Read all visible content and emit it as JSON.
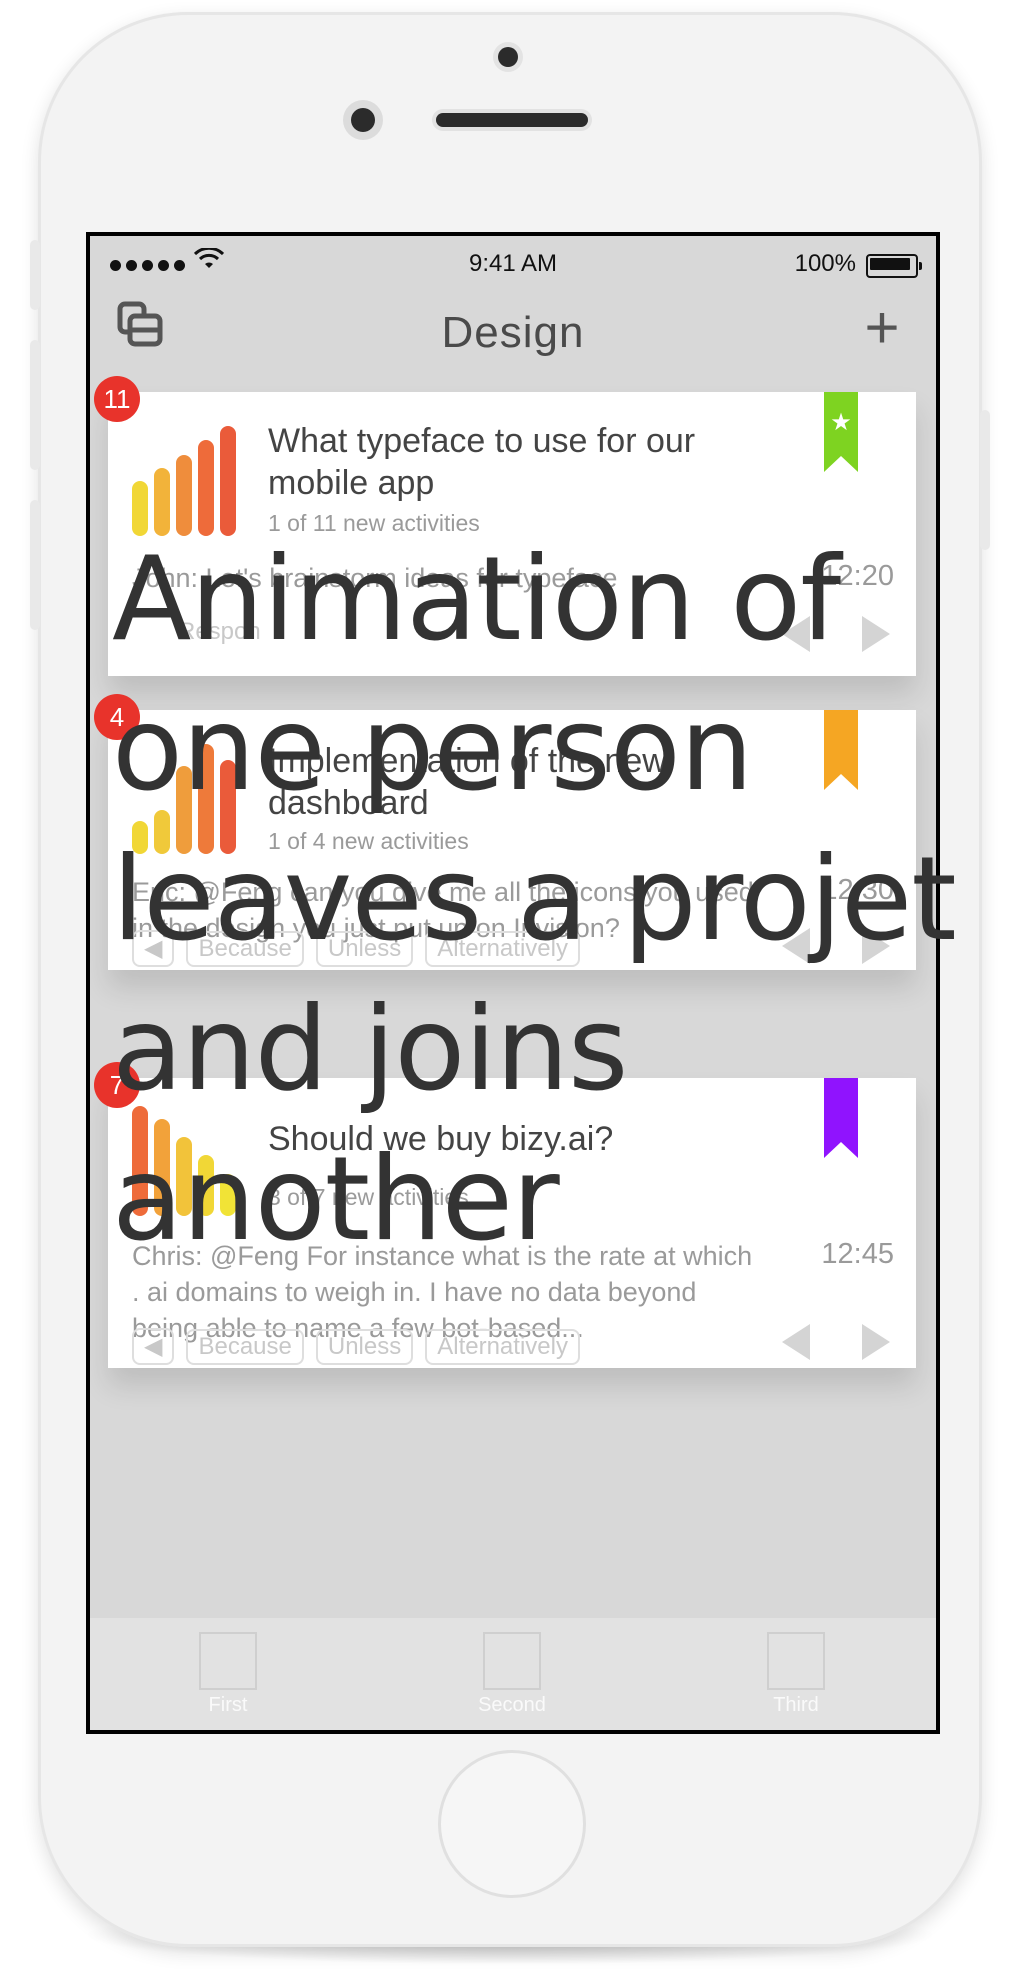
{
  "status_bar": {
    "carrier_signal": "●●●●●",
    "wifi_icon": "wifi-icon",
    "time": "9:41 AM",
    "battery_percent": "100%"
  },
  "nav": {
    "title": "Design",
    "add_symbol": "+"
  },
  "cards": [
    {
      "badge": "11",
      "title": "What typeface to use for our mobile app",
      "subtitle": "1 of 11 new activities",
      "bookmark_color": "#7ed321",
      "bookmark_star": "★",
      "message": "John: Let's brainstorm ideas for typeface",
      "time": "12:20",
      "actions": [
        "Respon"
      ],
      "bar_colors": [
        "#f1d736",
        "#f2b33a",
        "#ef8d3c",
        "#ee6b3a",
        "#ea5b3a"
      ],
      "bar_heights_pct": [
        0.5,
        0.62,
        0.74,
        0.87,
        1.0
      ]
    },
    {
      "badge": "4",
      "title": "Implementation of the new dashboard",
      "subtitle": "1 of 4 new activities",
      "bookmark_color": "#f5a623",
      "message": "Eric: @Feng can you give me all the icons you used in the design you just put up on Invision?",
      "time": "12:30",
      "chips": [
        "Because",
        "Unless",
        "Alternatively"
      ],
      "bar_colors": [
        "#f1d736",
        "#f0c93a",
        "#ef9d3c",
        "#ee7a3a",
        "#ea5b3a"
      ],
      "bar_heights_pct": [
        0.3,
        0.4,
        0.8,
        1.0,
        0.85
      ]
    },
    {
      "badge": "7",
      "title": "Should we buy bizy.ai?",
      "subtitle": "3 of 7 new activities",
      "bookmark_color": "#9013fe",
      "message": "Chris: @Feng For instance what is the rate at which . ai domains to weigh in. I have no data beyond being able to name a few bot-based...",
      "time": "12:45",
      "chips": [
        "Because",
        "Unless",
        "Alternatively"
      ],
      "bar_colors": [
        "#ee6b3a",
        "#f2a23a",
        "#f2c33a",
        "#f1d736",
        "#f1e336"
      ],
      "bar_heights_pct": [
        1.0,
        0.88,
        0.72,
        0.55,
        0.38
      ]
    }
  ],
  "tabs": [
    {
      "label": "First"
    },
    {
      "label": "Second"
    },
    {
      "label": "Third"
    }
  ],
  "overlay_caption": "Animation of\none person\nleaves a projet\nand joins\nanother"
}
